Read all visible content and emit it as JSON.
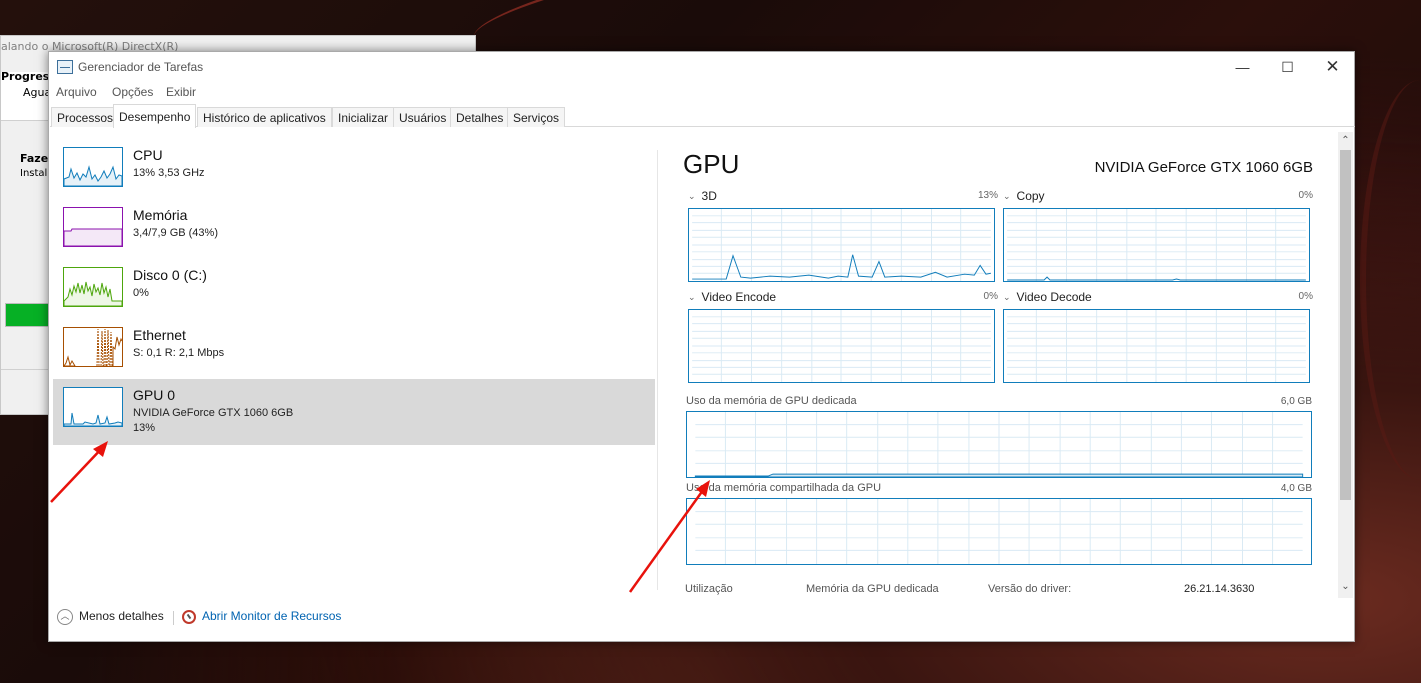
{
  "background_window": {
    "title": "alando o Microsoft(R) DirectX(R)",
    "progress_heading": "Progress",
    "waiting": "Agua",
    "doing_heading": "Fazer",
    "installing": "Instala"
  },
  "window": {
    "title": "Gerenciador de Tarefas",
    "controls": {
      "minimize": "—",
      "maximize": "☐",
      "close": "✕"
    }
  },
  "menu": [
    "Arquivo",
    "Opções",
    "Exibir"
  ],
  "tabs": [
    "Processos",
    "Desempenho",
    "Histórico de aplicativos",
    "Inicializar",
    "Usuários",
    "Detalhes",
    "Serviços"
  ],
  "active_tab": "Desempenho",
  "sidebar": {
    "items": [
      {
        "title": "CPU",
        "sub": "13%  3,53 GHz",
        "sub2": "",
        "color": "#117dbb"
      },
      {
        "title": "Memória",
        "sub": "3,4/7,9 GB (43%)",
        "sub2": "",
        "color": "#8b12ae"
      },
      {
        "title": "Disco 0 (C:)",
        "sub": "0%",
        "sub2": "",
        "color": "#4da60c"
      },
      {
        "title": "Ethernet",
        "sub": "S: 0,1  R: 2,1 Mbps",
        "sub2": "",
        "color": "#a74f01"
      },
      {
        "title": "GPU 0",
        "sub": "NVIDIA GeForce GTX 1060 6GB",
        "sub2": "13%",
        "color": "#117dbb",
        "selected": true
      }
    ]
  },
  "gpu": {
    "title": "GPU",
    "model": "NVIDIA GeForce GTX 1060 6GB",
    "engines": [
      {
        "name": "3D",
        "pct": "13%"
      },
      {
        "name": "Copy",
        "pct": "0%"
      },
      {
        "name": "Video Encode",
        "pct": "0%"
      },
      {
        "name": "Video Decode",
        "pct": "0%"
      }
    ],
    "dedicated_memory": {
      "label": "Uso da memória de GPU dedicada",
      "max": "6,0 GB"
    },
    "shared_memory": {
      "label": "Uso da memória compartilhada da GPU",
      "max": "4,0 GB"
    },
    "stats": {
      "utilization_label": "Utilização",
      "dedicated_label": "Memória da GPU dedicada",
      "driver_label": "Versão do driver:",
      "driver_value": "26.21.14.3630"
    }
  },
  "footer": {
    "fewer_details": "Menos detalhes",
    "resource_monitor": "Abrir Monitor de Recursos"
  },
  "scroll": {
    "up": "⌃",
    "down": "⌄"
  },
  "colors": {
    "graph_blue": "#117dbb",
    "annotation_red": "#e8120c",
    "link_blue": "#0063b1"
  }
}
